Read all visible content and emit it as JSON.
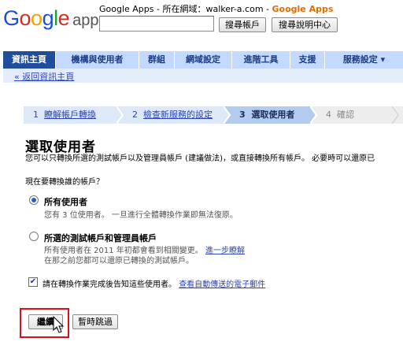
{
  "header": {
    "logo_google": "Google",
    "logo_apps": "apps",
    "domain_prefix": "Google Apps - 所在網域：",
    "domain": "walker-a.com",
    "domain_sep": " - ",
    "brand": "Google Apps",
    "search_value": "",
    "search_account_button": "搜尋帳戶",
    "search_help_button": "搜尋說明中心"
  },
  "nav": {
    "tabs": [
      {
        "label": "資訊主頁"
      },
      {
        "label": "機構與使用者"
      },
      {
        "label": "群組"
      },
      {
        "label": "網域設定"
      },
      {
        "label": "進階工具"
      },
      {
        "label": "支援"
      },
      {
        "label": "服務設定 ▾"
      }
    ],
    "back_link": "« 返回資訊主頁"
  },
  "steps": {
    "s1_num": "1",
    "s1_label": "瞭解帳戶轉換",
    "s2_num": "2",
    "s2_label": "檢查新服務的設定",
    "s3_num": "3",
    "s3_label": "選取使用者",
    "s4_num": "4",
    "s4_label": "確認"
  },
  "main": {
    "title": "選取使用者",
    "description": "您可以只轉換所選的測試帳戶以及管理員帳戶 (建議做法)，或直接轉換所有帳戶。 必要時可以還原已",
    "question": "現在要轉換誰的帳戶？",
    "option_all_title": "所有使用者",
    "option_all_sub": "您有 3 位使用者。 一旦進行全體轉換作業即無法復原。",
    "option_test_title": "所選的測試帳戶和管理員帳戶",
    "option_test_sub1": "所有使用者在 2011 年初都會看到相關變更。 ",
    "option_test_link": "進一步瞭解",
    "option_test_sub2": "在那之前您都可以還原已轉換的測試帳戶。",
    "notify_label": "請在轉換作業完成後告知這些使用者。 ",
    "notify_link": "查看自動傳送的電子郵件",
    "checkbox_mark": "✔",
    "continue_button": "繼續",
    "skip_button": "暫時跳過"
  },
  "colors": {
    "nav_bg": "#c3d9ff",
    "nav_active": "#1f4f9c",
    "link": "#2c45b8",
    "highlight": "#d9101a",
    "brand_orange": "#e06b00"
  }
}
